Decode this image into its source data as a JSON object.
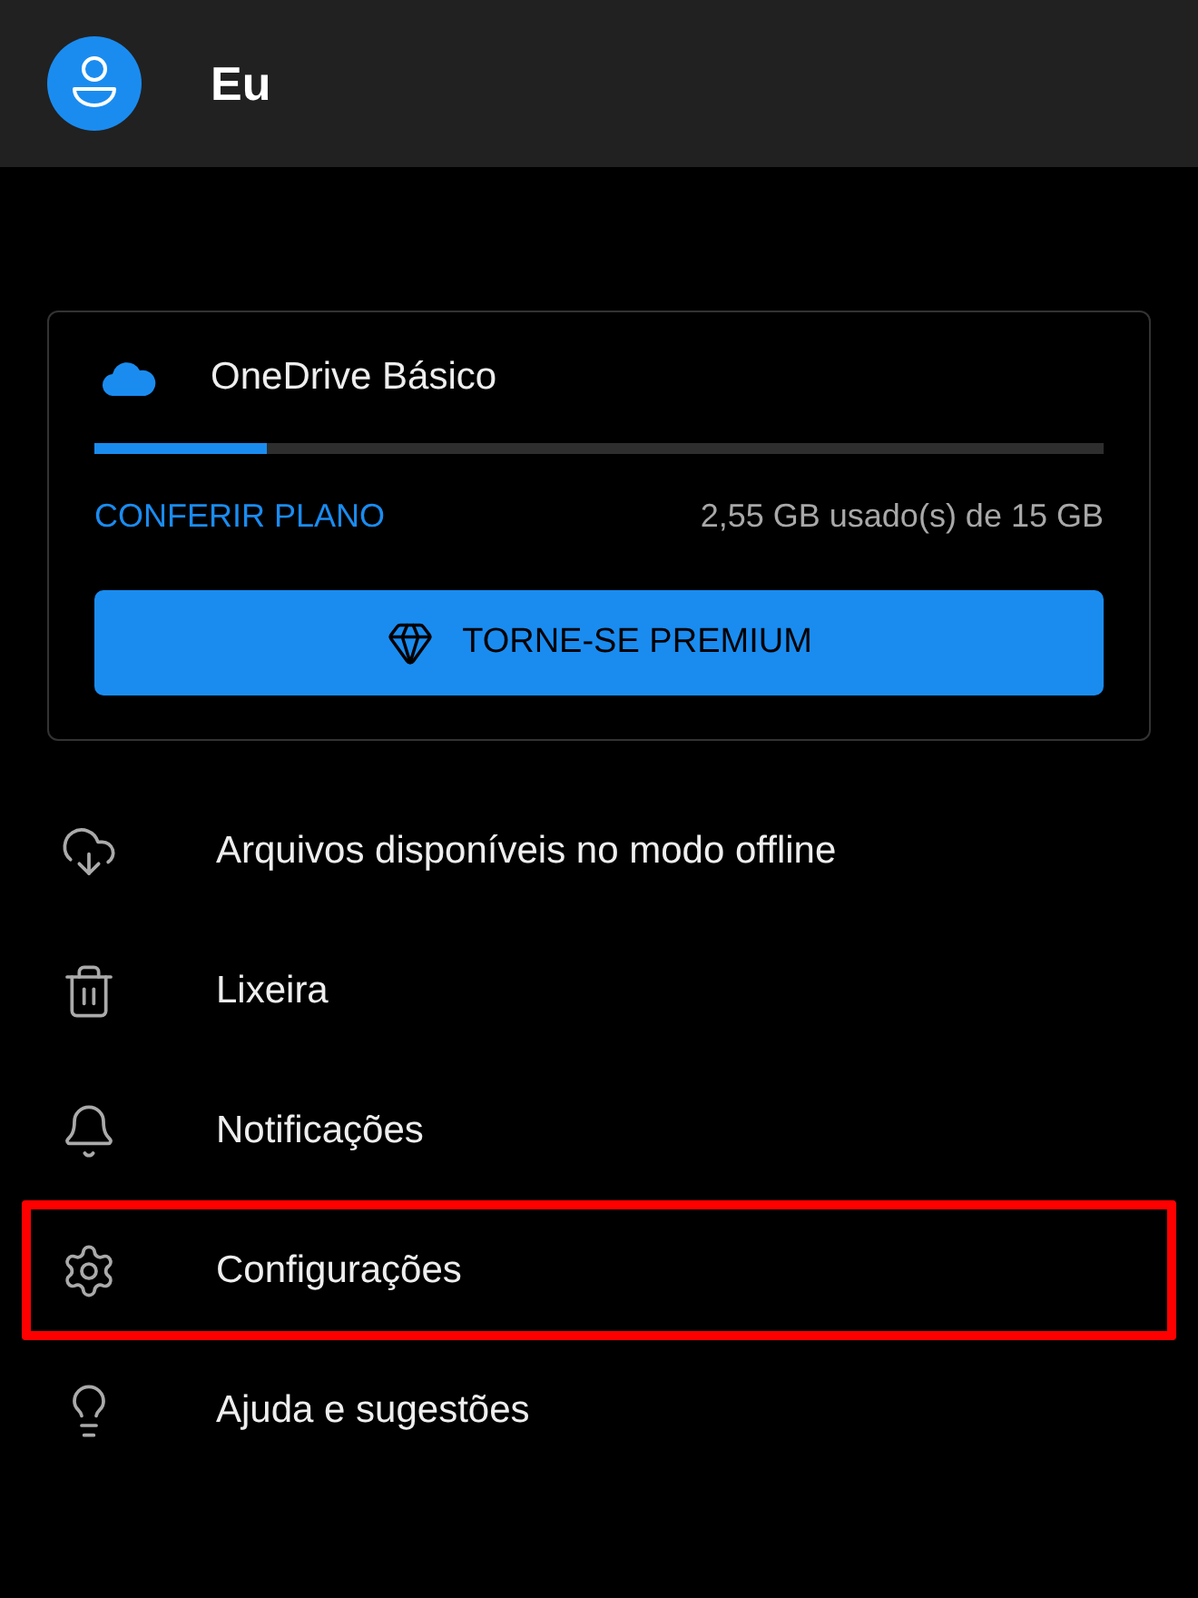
{
  "header": {
    "title": "Eu"
  },
  "plan_card": {
    "plan_name": "OneDrive Básico",
    "level": 0.17,
    "link": "CONFERIR PLANO",
    "usage": "2,55 GB usado(s) de 15 GB",
    "button": "TORNE-SE PREMIUM"
  },
  "menu": [
    {
      "kind": "offline",
      "label": "Arquivos disponíveis no modo offline",
      "highlighted": false
    },
    {
      "kind": "trash",
      "label": "Lixeira",
      "highlighted": false
    },
    {
      "kind": "notifications",
      "label": "Notificações",
      "highlighted": false
    },
    {
      "kind": "settings",
      "label": "Configurações",
      "highlighted": true
    },
    {
      "kind": "help",
      "label": "Ajuda e sugestões",
      "highlighted": false
    }
  ]
}
